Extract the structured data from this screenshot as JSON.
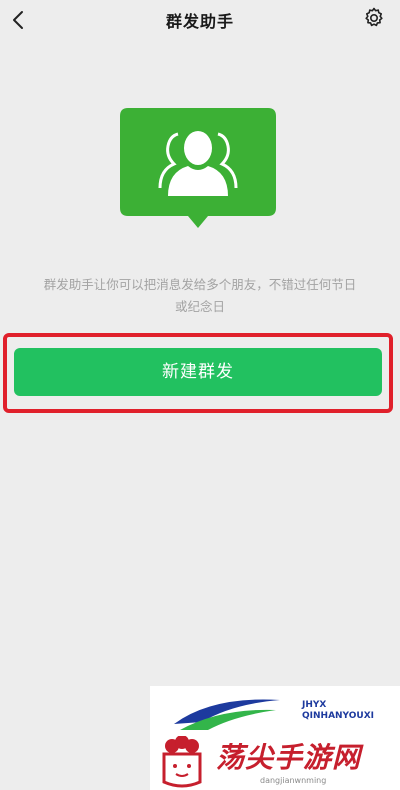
{
  "nav": {
    "back_icon": "chevron-left-icon",
    "title": "群发助手",
    "settings_icon": "gear-icon"
  },
  "hero": {
    "icon": "group-contacts-icon",
    "color": "#3cb035"
  },
  "description": {
    "line1": "群发助手让你可以把消息发给多个朋友，不错过任何节日",
    "line2": "或纪念日"
  },
  "primary_action": {
    "label": "新建群发",
    "color": "#22c160"
  },
  "highlight": {
    "color": "#e0202b"
  },
  "watermark": {
    "logo_letters": "JHYX",
    "english": "QINHANYOUXI",
    "chinese": "荡尖手游网",
    "url": "dangjianwnming"
  }
}
